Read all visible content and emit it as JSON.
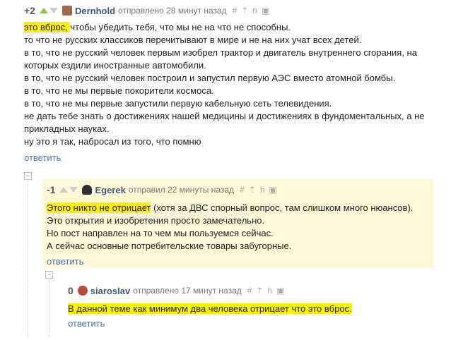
{
  "comments": [
    {
      "score": "+2",
      "author": "Dernhold",
      "meta": "отправлено 28 минут назад",
      "tools": [
        "#",
        "⇡",
        "h",
        "▣"
      ],
      "highlight": "это вброс, ",
      "first_rest": "чтобы убедить тебя, что мы не на что не способны.",
      "lines": [
        "то что не русских классиков перечитывают в мире и не на них учат всех детей.",
        "в то, что не русский человек первым изобрел трактор и двигатель внутреннего сгорания, на",
        "которых ездили иностранные автомобили.",
        "в то, что не русский человек построил и запустил первую АЭС вместо атомной бомбы.",
        "в то, что не мы первые покорители космоса.",
        "в то, что не мы первые запустили первую кабельную сеть телевидения.",
        "не дать тебе знать о достижениях нашей медицины и достижениях в фундоментальных, а не",
        "прикладных науках.",
        "ну это я так, набросал из того, что помню"
      ],
      "reply": "ответить"
    },
    {
      "score": "-1",
      "author": "Egerek",
      "meta": "отправил 22 минуты назад",
      "tools": [
        "#",
        "⇡",
        "h",
        "▣"
      ],
      "highlight": "Этого никто не отрицает",
      "first_rest": " (хотя за ДВС спорный вопрос, там слишком много нюансов).",
      "lines": [
        "Это открытия и изобретения просто замечательно.",
        "Но пост направлен на то чем мы пользуемся сейчас.",
        "А сейчас основные потребительские товары забугорные."
      ],
      "reply": "ответить"
    },
    {
      "score": "0",
      "author": "siaroslav",
      "meta": "отправлено 17 минут назад",
      "tools": [
        "#",
        "⇡",
        "h",
        "▣"
      ],
      "highlight": "В данной теме как минимум два человека отрицает что это вброс.",
      "first_rest": "",
      "lines": [],
      "reply": "ответить"
    }
  ],
  "colors": {
    "highlight": "#fff200",
    "link": "#4a74b4",
    "author": "#41587a",
    "upvote": "#8ec641",
    "yellow_box": "#fef8d8"
  },
  "collapse_symbol": "−"
}
